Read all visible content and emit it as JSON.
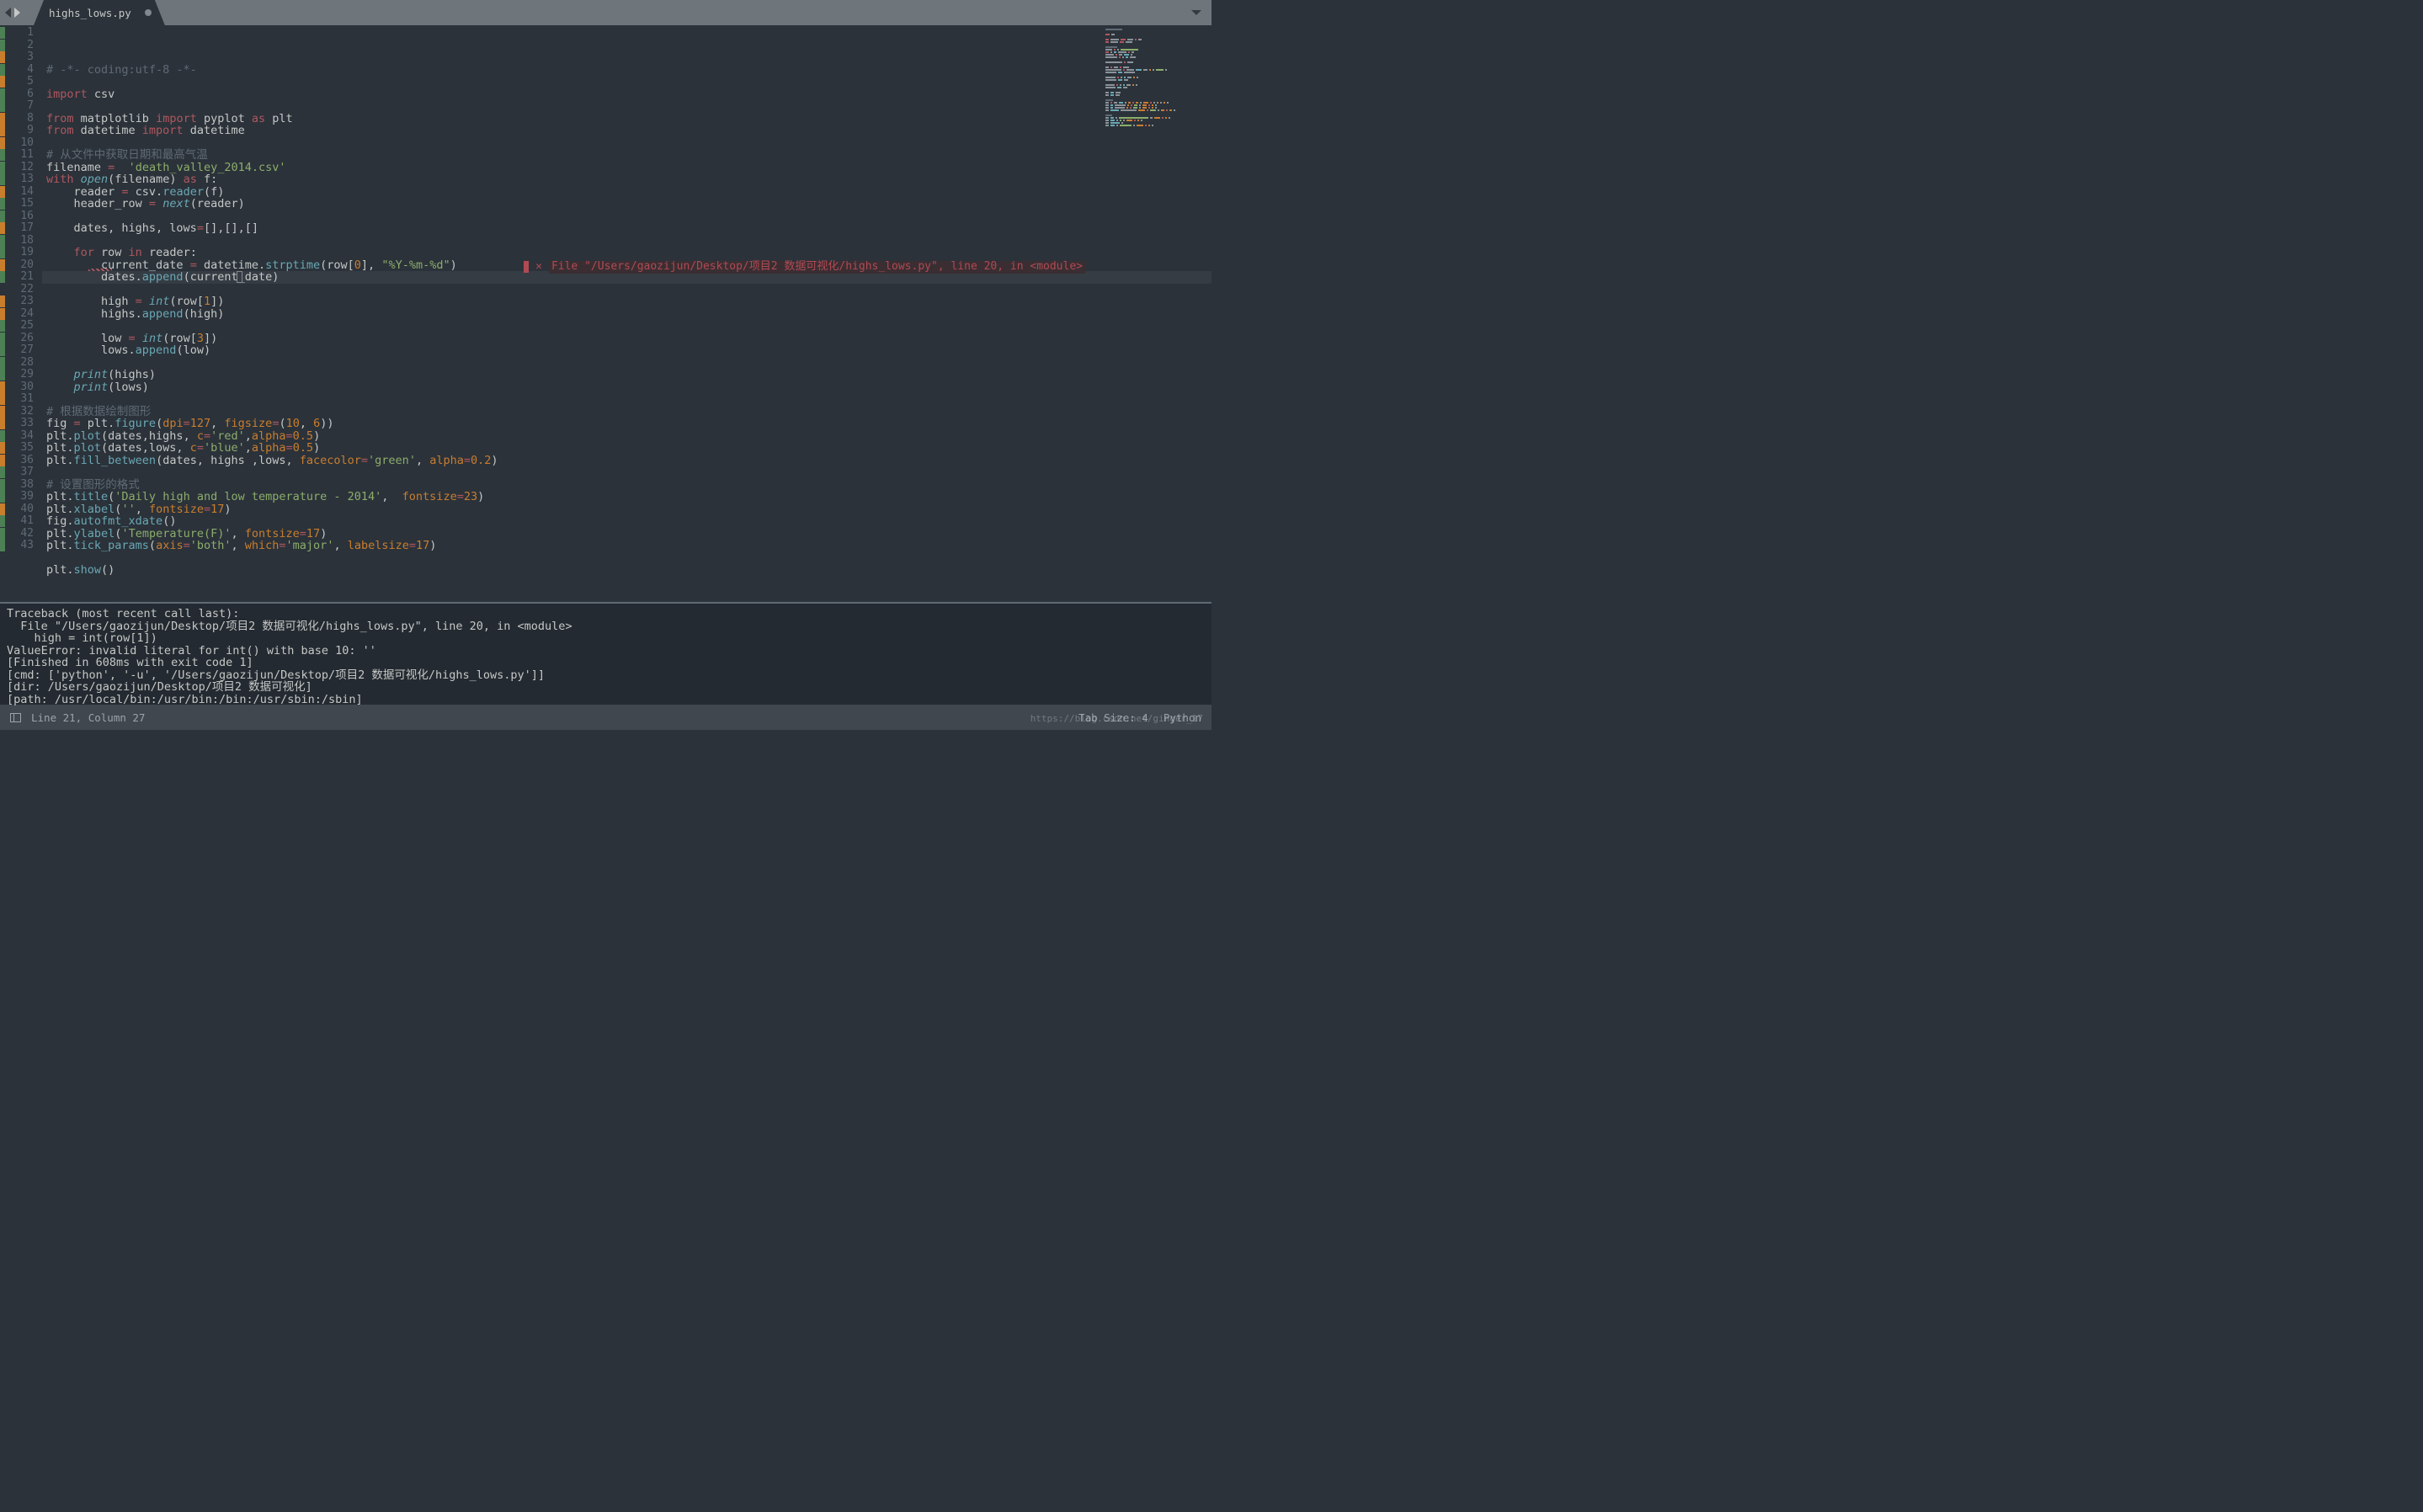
{
  "tab": {
    "name": "highs_lows.py",
    "dirty": true
  },
  "gutter": {
    "lines": 43,
    "active": 21,
    "marks": {
      "1": "green",
      "2": "green",
      "3": "orange",
      "4": "green",
      "5": "orange",
      "6": "green",
      "7": "green",
      "8": "orange",
      "9": "orange",
      "10": "orange",
      "11": "green",
      "12": "green",
      "13": "green",
      "14": "orange",
      "15": "green",
      "16": "green",
      "17": "orange",
      "18": "green",
      "19": "green",
      "20": "orange",
      "21": "green",
      "23": "orange",
      "24": "orange",
      "25": "green",
      "26": "green",
      "27": "green",
      "28": "green",
      "29": "green",
      "30": "orange",
      "31": "orange",
      "32": "orange",
      "33": "orange",
      "34": "green",
      "35": "orange",
      "36": "orange",
      "37": "green",
      "38": "green",
      "39": "green",
      "40": "orange",
      "41": "green",
      "42": "green",
      "43": "green"
    }
  },
  "code": [
    [
      {
        "t": "# -*- coding:utf-8 -*-",
        "c": "comment"
      }
    ],
    [],
    [
      {
        "t": "import",
        "c": "keyword"
      },
      {
        "t": " csv",
        "c": "attr"
      }
    ],
    [],
    [
      {
        "t": "from",
        "c": "keyword"
      },
      {
        "t": " matplotlib ",
        "c": "attr"
      },
      {
        "t": "import",
        "c": "keyword"
      },
      {
        "t": " pyplot ",
        "c": "attr"
      },
      {
        "t": "as",
        "c": "keyword"
      },
      {
        "t": " plt",
        "c": "attr"
      }
    ],
    [
      {
        "t": "from",
        "c": "keyword"
      },
      {
        "t": " datetime ",
        "c": "attr"
      },
      {
        "t": "import",
        "c": "keyword"
      },
      {
        "t": " datetime",
        "c": "attr"
      }
    ],
    [],
    [
      {
        "t": "# 从文件中获取日期和最高气温",
        "c": "comment"
      }
    ],
    [
      {
        "t": "filename ",
        "c": "attr"
      },
      {
        "t": "=",
        "c": "keyword"
      },
      {
        "t": "  ",
        "c": "attr"
      },
      {
        "t": "'death_valley_2014.csv'",
        "c": "string"
      }
    ],
    [
      {
        "t": "with",
        "c": "keyword"
      },
      {
        "t": " ",
        "c": "attr"
      },
      {
        "t": "open",
        "c": "builtin"
      },
      {
        "t": "(filename) ",
        "c": "attr"
      },
      {
        "t": "as",
        "c": "keyword"
      },
      {
        "t": " f:",
        "c": "attr"
      }
    ],
    [
      {
        "t": "    reader ",
        "c": "attr"
      },
      {
        "t": "=",
        "c": "keyword"
      },
      {
        "t": " csv.",
        "c": "attr"
      },
      {
        "t": "reader",
        "c": "func"
      },
      {
        "t": "(f)",
        "c": "attr"
      }
    ],
    [
      {
        "t": "    header_row ",
        "c": "attr"
      },
      {
        "t": "=",
        "c": "keyword"
      },
      {
        "t": " ",
        "c": "attr"
      },
      {
        "t": "next",
        "c": "builtin"
      },
      {
        "t": "(reader)",
        "c": "attr"
      }
    ],
    [],
    [
      {
        "t": "    dates, highs, lows",
        "c": "attr"
      },
      {
        "t": "=",
        "c": "keyword"
      },
      {
        "t": "[],[],[]",
        "c": "attr"
      }
    ],
    [],
    [
      {
        "t": "    ",
        "c": "attr"
      },
      {
        "t": "for",
        "c": "keyword"
      },
      {
        "t": " row ",
        "c": "attr"
      },
      {
        "t": "in",
        "c": "keyword"
      },
      {
        "t": " reader:",
        "c": "attr"
      }
    ],
    [
      {
        "t": "        current_date ",
        "c": "attr"
      },
      {
        "t": "=",
        "c": "keyword"
      },
      {
        "t": " datetime.",
        "c": "attr"
      },
      {
        "t": "strptime",
        "c": "func"
      },
      {
        "t": "(row[",
        "c": "attr"
      },
      {
        "t": "0",
        "c": "num"
      },
      {
        "t": "], ",
        "c": "attr"
      },
      {
        "t": "\"%Y-%m-%d\"",
        "c": "string"
      },
      {
        "t": ")",
        "c": "attr"
      }
    ],
    [
      {
        "t": "        dates.",
        "c": "attr"
      },
      {
        "t": "append",
        "c": "func"
      },
      {
        "t": "(current_date)",
        "c": "attr"
      }
    ],
    [],
    [
      {
        "t": "        high ",
        "c": "attr"
      },
      {
        "t": "=",
        "c": "keyword"
      },
      {
        "t": " ",
        "c": "attr"
      },
      {
        "t": "int",
        "c": "builtin"
      },
      {
        "t": "(row[",
        "c": "attr"
      },
      {
        "t": "1",
        "c": "num"
      },
      {
        "t": "])",
        "c": "attr"
      }
    ],
    [
      {
        "t": "        highs.",
        "c": "attr"
      },
      {
        "t": "append",
        "c": "func"
      },
      {
        "t": "(high)",
        "c": "attr"
      }
    ],
    [],
    [
      {
        "t": "        low ",
        "c": "attr"
      },
      {
        "t": "=",
        "c": "keyword"
      },
      {
        "t": " ",
        "c": "attr"
      },
      {
        "t": "int",
        "c": "builtin"
      },
      {
        "t": "(row[",
        "c": "attr"
      },
      {
        "t": "3",
        "c": "num"
      },
      {
        "t": "])",
        "c": "attr"
      }
    ],
    [
      {
        "t": "        lows.",
        "c": "attr"
      },
      {
        "t": "append",
        "c": "func"
      },
      {
        "t": "(low)",
        "c": "attr"
      }
    ],
    [],
    [
      {
        "t": "    ",
        "c": "attr"
      },
      {
        "t": "print",
        "c": "builtin"
      },
      {
        "t": "(highs)",
        "c": "attr"
      }
    ],
    [
      {
        "t": "    ",
        "c": "attr"
      },
      {
        "t": "print",
        "c": "builtin"
      },
      {
        "t": "(lows)",
        "c": "attr"
      }
    ],
    [],
    [
      {
        "t": "# 根据数据绘制图形",
        "c": "comment"
      }
    ],
    [
      {
        "t": "fig ",
        "c": "attr"
      },
      {
        "t": "=",
        "c": "keyword"
      },
      {
        "t": " plt.",
        "c": "attr"
      },
      {
        "t": "figure",
        "c": "func"
      },
      {
        "t": "(",
        "c": "attr"
      },
      {
        "t": "dpi",
        "c": "param"
      },
      {
        "t": "=",
        "c": "keyword"
      },
      {
        "t": "127",
        "c": "num"
      },
      {
        "t": ", ",
        "c": "attr"
      },
      {
        "t": "figsize",
        "c": "param"
      },
      {
        "t": "=",
        "c": "keyword"
      },
      {
        "t": "(",
        "c": "attr"
      },
      {
        "t": "10",
        "c": "num"
      },
      {
        "t": ", ",
        "c": "attr"
      },
      {
        "t": "6",
        "c": "num"
      },
      {
        "t": "))",
        "c": "attr"
      }
    ],
    [
      {
        "t": "plt.",
        "c": "attr"
      },
      {
        "t": "plot",
        "c": "func"
      },
      {
        "t": "(dates,highs, ",
        "c": "attr"
      },
      {
        "t": "c",
        "c": "param"
      },
      {
        "t": "=",
        "c": "keyword"
      },
      {
        "t": "'red'",
        "c": "string"
      },
      {
        "t": ",",
        "c": "attr"
      },
      {
        "t": "alpha",
        "c": "param"
      },
      {
        "t": "=",
        "c": "keyword"
      },
      {
        "t": "0.5",
        "c": "num"
      },
      {
        "t": ")",
        "c": "attr"
      }
    ],
    [
      {
        "t": "plt.",
        "c": "attr"
      },
      {
        "t": "plot",
        "c": "func"
      },
      {
        "t": "(dates,lows, ",
        "c": "attr"
      },
      {
        "t": "c",
        "c": "param"
      },
      {
        "t": "=",
        "c": "keyword"
      },
      {
        "t": "'blue'",
        "c": "string"
      },
      {
        "t": ",",
        "c": "attr"
      },
      {
        "t": "alpha",
        "c": "param"
      },
      {
        "t": "=",
        "c": "keyword"
      },
      {
        "t": "0.5",
        "c": "num"
      },
      {
        "t": ")",
        "c": "attr"
      }
    ],
    [
      {
        "t": "plt.",
        "c": "attr"
      },
      {
        "t": "fill_between",
        "c": "func"
      },
      {
        "t": "(dates, highs ,lows, ",
        "c": "attr"
      },
      {
        "t": "facecolor",
        "c": "param"
      },
      {
        "t": "=",
        "c": "keyword"
      },
      {
        "t": "'green'",
        "c": "string"
      },
      {
        "t": ", ",
        "c": "attr"
      },
      {
        "t": "alpha",
        "c": "param"
      },
      {
        "t": "=",
        "c": "keyword"
      },
      {
        "t": "0.2",
        "c": "num"
      },
      {
        "t": ")",
        "c": "attr"
      }
    ],
    [],
    [
      {
        "t": "# 设置图形的格式",
        "c": "comment"
      }
    ],
    [
      {
        "t": "plt.",
        "c": "attr"
      },
      {
        "t": "title",
        "c": "func"
      },
      {
        "t": "(",
        "c": "attr"
      },
      {
        "t": "'Daily high and low temperature - 2014'",
        "c": "string"
      },
      {
        "t": ",  ",
        "c": "attr"
      },
      {
        "t": "fontsize",
        "c": "param"
      },
      {
        "t": "=",
        "c": "keyword"
      },
      {
        "t": "23",
        "c": "num"
      },
      {
        "t": ")",
        "c": "attr"
      }
    ],
    [
      {
        "t": "plt.",
        "c": "attr"
      },
      {
        "t": "xlabel",
        "c": "func"
      },
      {
        "t": "(",
        "c": "attr"
      },
      {
        "t": "''",
        "c": "string"
      },
      {
        "t": ", ",
        "c": "attr"
      },
      {
        "t": "fontsize",
        "c": "param"
      },
      {
        "t": "=",
        "c": "keyword"
      },
      {
        "t": "17",
        "c": "num"
      },
      {
        "t": ")",
        "c": "attr"
      }
    ],
    [
      {
        "t": "fig.",
        "c": "attr"
      },
      {
        "t": "autofmt_xdate",
        "c": "func"
      },
      {
        "t": "()",
        "c": "attr"
      }
    ],
    [
      {
        "t": "plt.",
        "c": "attr"
      },
      {
        "t": "ylabel",
        "c": "func"
      },
      {
        "t": "(",
        "c": "attr"
      },
      {
        "t": "'Temperature(F)'",
        "c": "string"
      },
      {
        "t": ", ",
        "c": "attr"
      },
      {
        "t": "fontsize",
        "c": "param"
      },
      {
        "t": "=",
        "c": "keyword"
      },
      {
        "t": "17",
        "c": "num"
      },
      {
        "t": ")",
        "c": "attr"
      }
    ],
    [
      {
        "t": "plt.",
        "c": "attr"
      },
      {
        "t": "tick_params",
        "c": "func"
      },
      {
        "t": "(",
        "c": "attr"
      },
      {
        "t": "axis",
        "c": "param"
      },
      {
        "t": "=",
        "c": "keyword"
      },
      {
        "t": "'both'",
        "c": "string"
      },
      {
        "t": ", ",
        "c": "attr"
      },
      {
        "t": "which",
        "c": "param"
      },
      {
        "t": "=",
        "c": "keyword"
      },
      {
        "t": "'major'",
        "c": "string"
      },
      {
        "t": ", ",
        "c": "attr"
      },
      {
        "t": "labelsize",
        "c": "param"
      },
      {
        "t": "=",
        "c": "keyword"
      },
      {
        "t": "17",
        "c": "num"
      },
      {
        "t": ")",
        "c": "attr"
      }
    ],
    [],
    [
      {
        "t": "plt.",
        "c": "attr"
      },
      {
        "t": "show",
        "c": "func"
      },
      {
        "t": "()",
        "c": "attr"
      }
    ],
    []
  ],
  "inline_error": {
    "x_label": "✕",
    "text": "File \"/Users/gaozijun/Desktop/项目2 数据可视化/highs_lows.py\", line 20, in <module>"
  },
  "console": "Traceback (most recent call last):\n  File \"/Users/gaozijun/Desktop/项目2 数据可视化/highs_lows.py\", line 20, in <module>\n    high = int(row[1])\nValueError: invalid literal for int() with base 10: ''\n[Finished in 608ms with exit code 1]\n[cmd: ['python', '-u', '/Users/gaozijun/Desktop/项目2 数据可视化/highs_lows.py']]\n[dir: /Users/gaozijun/Desktop/项目2 数据可视化]\n[path: /usr/local/bin:/usr/bin:/bin:/usr/sbin:/sbin]",
  "status": {
    "position": "Line 21, Column 27",
    "tabsize": "Tab Size: 4",
    "language": "Python"
  },
  "watermark": "https://blog.csdn.net/ginger_17"
}
